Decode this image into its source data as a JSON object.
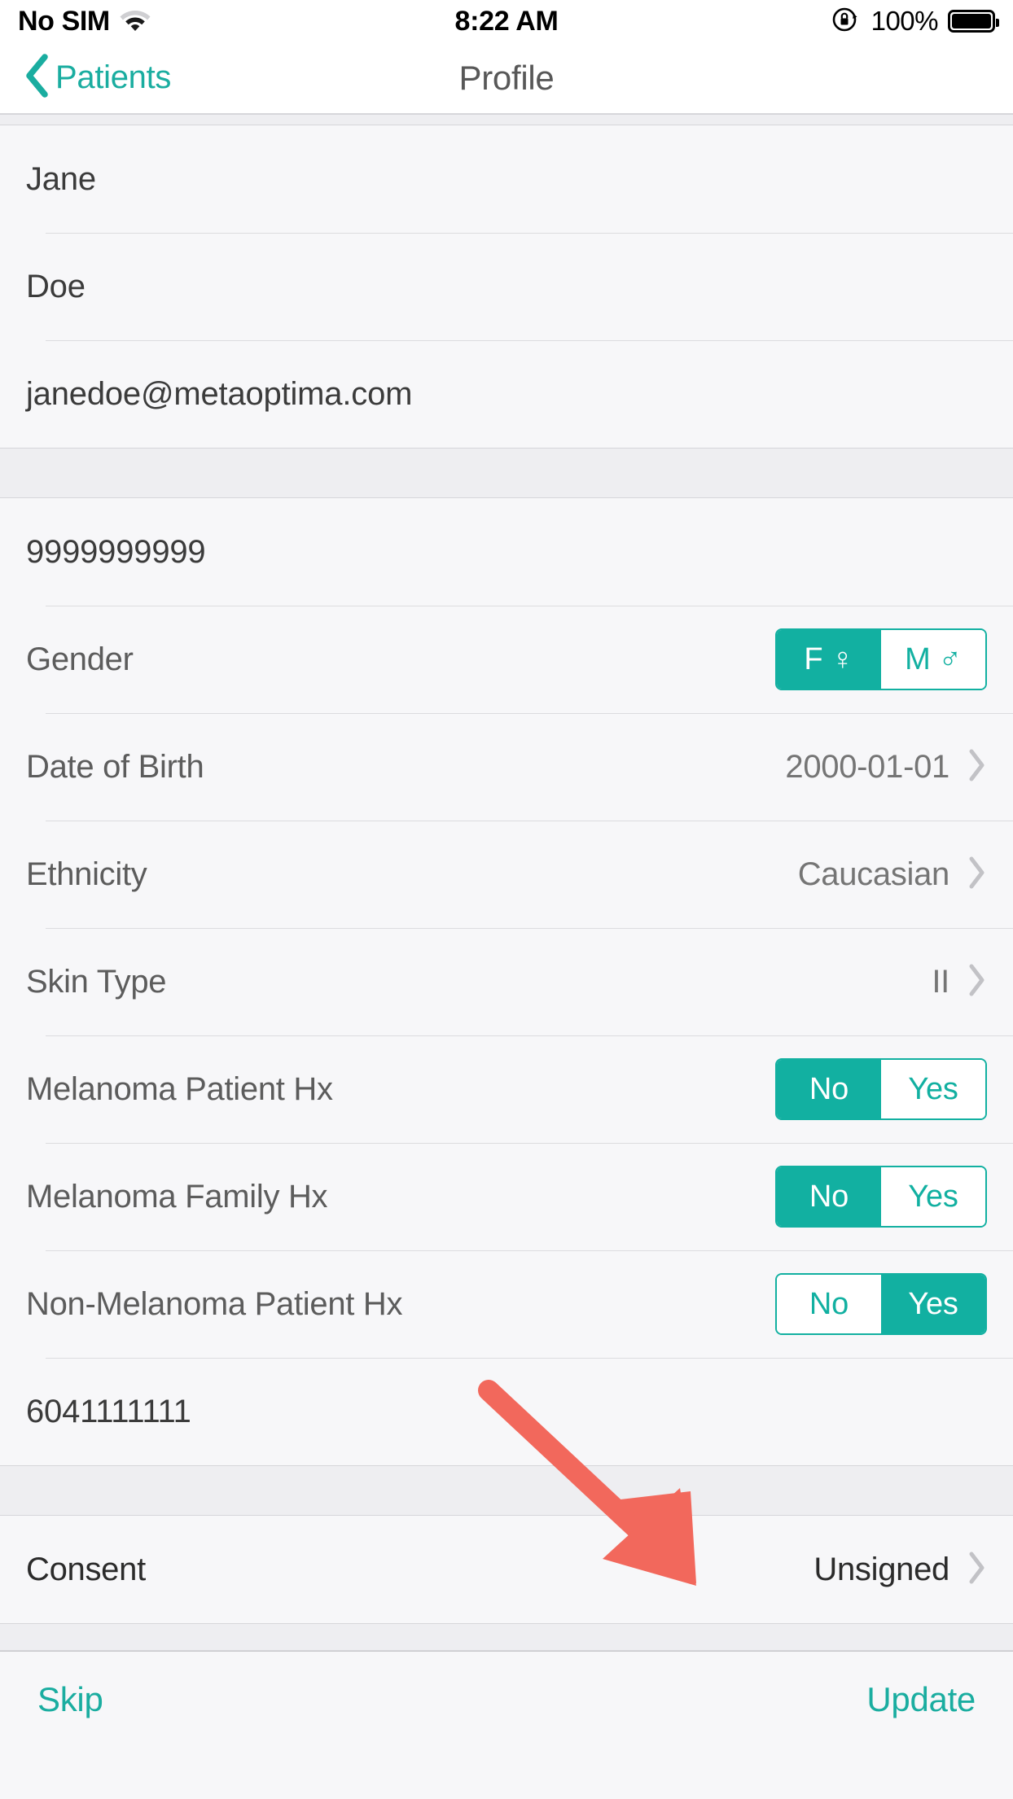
{
  "statusbar": {
    "carrier": "No SIM",
    "wifi_icon": "wifi-icon",
    "time": "8:22 AM",
    "rotation_lock_icon": "rotation-lock-icon",
    "battery_percent": "100%",
    "battery_icon": "battery-full-icon"
  },
  "navbar": {
    "back_label": "Patients",
    "back_icon": "chevron-left-icon",
    "title": "Profile"
  },
  "sections": {
    "identity": [
      {
        "name": "first-name",
        "value": "Jane"
      },
      {
        "name": "last-name",
        "value": "Doe"
      },
      {
        "name": "email",
        "value": "janedoe@metaoptima.com"
      }
    ],
    "clinical": {
      "health_number": {
        "name": "health-number",
        "value": "9999999999"
      },
      "gender": {
        "label": "Gender",
        "options": [
          {
            "label": "F",
            "symbol": "♀",
            "selected": true
          },
          {
            "label": "M",
            "symbol": "♂",
            "selected": false
          }
        ]
      },
      "date_of_birth": {
        "label": "Date of Birth",
        "value": "2000-01-01"
      },
      "ethnicity": {
        "label": "Ethnicity",
        "value": "Caucasian"
      },
      "skin_type": {
        "label": "Skin Type",
        "value": "II"
      },
      "melanoma_patient_hx": {
        "label": "Melanoma Patient Hx",
        "options": [
          {
            "label": "No",
            "selected": true
          },
          {
            "label": "Yes",
            "selected": false
          }
        ]
      },
      "melanoma_family_hx": {
        "label": "Melanoma Family Hx",
        "options": [
          {
            "label": "No",
            "selected": true
          },
          {
            "label": "Yes",
            "selected": false
          }
        ]
      },
      "non_melanoma_patient_hx": {
        "label": "Non-Melanoma Patient Hx",
        "options": [
          {
            "label": "No",
            "selected": false
          },
          {
            "label": "Yes",
            "selected": true
          }
        ]
      },
      "phone": {
        "name": "phone-number",
        "value": "6041111111"
      }
    },
    "consent": {
      "label": "Consent",
      "value": "Unsigned"
    }
  },
  "toolbar": {
    "skip_label": "Skip",
    "update_label": "Update"
  },
  "annotation": {
    "arrow_icon": "red-arrow-annotation",
    "color": "#f2685c"
  },
  "colors": {
    "accent_teal": "#12b0a1",
    "link_teal": "#1aada0",
    "page_bg": "#f7f7f9",
    "section_gap": "#eeeef1",
    "label_gray": "#5c5c5c",
    "value_gray": "#757575",
    "annotation_red": "#f2685c"
  }
}
